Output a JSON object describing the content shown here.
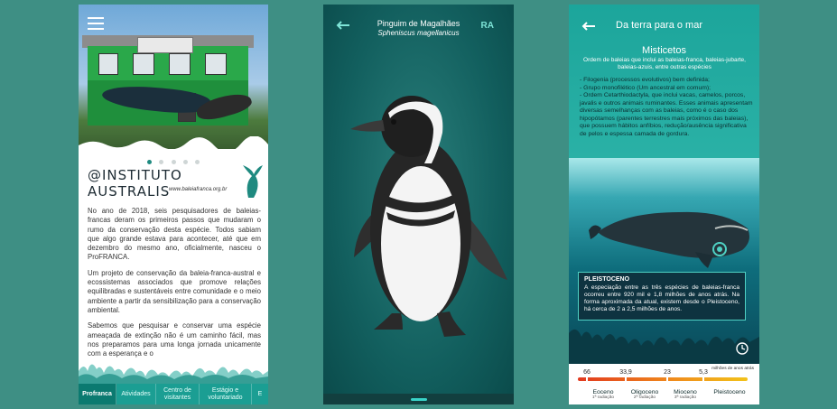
{
  "screen1": {
    "menu_icon": "hamburger-menu-icon",
    "building_sign": "Centro Nacional de Conservação da Baleia Franca",
    "logo_name": "@INSTITUTO AUSTRALIS",
    "logo_url": "www.baleiafranca.org.br",
    "carousel_pages": 5,
    "carousel_active": 1,
    "paragraphs": [
      "No ano de 2018, seis pesquisadores de baleias-francas deram os primeiros passos que mudaram o rumo da conservação desta espécie. Todos sabiam que algo grande estava para acontecer, até que em dezembro do mesmo ano, oficialmente, nasceu o ProFRANCA.",
      "Um projeto de conservação da baleia-franca-austral e ecossistemas associados que promove relações equilibradas e sustentáveis entre comunidade e o meio ambiente a partir da sensibilização para a conservação ambiental.",
      "Sabemos que pesquisar e conservar uma espécie ameaçada de extinção não é um caminho fácil, mas nos preparamos para uma longa jornada unicamente com a esperança e o"
    ],
    "tabs": [
      {
        "label": "Profranca",
        "active": true
      },
      {
        "label": "Atividades",
        "active": false
      },
      {
        "label": "Centro de visitantes",
        "active": false
      },
      {
        "label": "Estágio e voluntariado",
        "active": false
      },
      {
        "label": "E",
        "active": false
      }
    ],
    "colors": {
      "accent": "#1b9e93",
      "active_tab": "#0b7a70"
    }
  },
  "screen2": {
    "back_icon": "arrow-left-icon",
    "title": "Pinguim de Magalhães",
    "subtitle": "Spheniscus magellanicus",
    "ra_button": "RA",
    "colors": {
      "accent": "#7ee5d8",
      "background": "#125f5e"
    }
  },
  "screen3": {
    "back_icon": "arrow-left-icon",
    "title": "Da terra para o mar",
    "heading": "Misticetos",
    "subheading": "Ordem de baleias que inclui as baleias-franca, baleias-jubarte, baleias-azuis, entre outras espécies",
    "list": [
      "- Filogenia (processos evolutivos) bem definida;",
      "- Grupo monofilético (Um ancestral em comum);",
      "- Ordem Cetarthiodactyla, que inclui vacas, camelos, porcos, javalis e outros animais ruminantes. Esses animais apresentam diversas semelhanças com as baleias, como é o caso dos hipopótamos (parentes terrestres mais próximos das baleias), que possuem hábitos anfíbios, redução/ausência significativa de pelos e espessa camada de gordura."
    ],
    "info_title": "PLEISTOCENO",
    "info_text": "A especiação entre as três espécies de baleias-franca ocorreu entre 920 mil e 1,8 milhões de anos atrás. Na forma aproximada da atual, existem desde o Pleistoceno, há cerca de 2 a 2,5 milhões de anos.",
    "clock_icon": "clock-icon",
    "timeline": {
      "unit": "milhões de anos atrás",
      "ticks": [
        "66",
        "33,9",
        "23",
        "5,3"
      ],
      "epochs": [
        {
          "label": "Eoceno",
          "note": "1ª radiação"
        },
        {
          "label": "Oligoceno",
          "note": "2ª radiação"
        },
        {
          "label": "Mioceno",
          "note": "3ª radiação"
        },
        {
          "label": "Pleistoceno",
          "note": ""
        }
      ]
    },
    "colors": {
      "accent": "#4fd1c4",
      "bar_start": "#e2391f",
      "bar_end": "#f2c21a"
    }
  }
}
